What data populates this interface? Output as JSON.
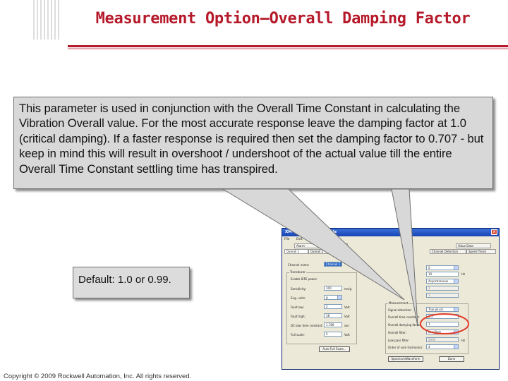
{
  "slide": {
    "title": "Measurement Option–Overall Damping Factor",
    "callout_text": "This parameter is used in conjunction with the Overall Time Constant in calculating the Vibration Overall value. For the most accurate response leave the damping factor at 1.0 (critical damping). If a faster response is required then set the damping factor to 0.707 - but keep in mind this will result in overshoot / undershoot of the actual value till the entire Overall Time Constant settling time has transpired.",
    "default_text": "Default: 1.0 or 0.99.",
    "copyright": "Copyright © 2009 Rockwell Automation, Inc. All rights reserved.",
    "colors": {
      "title": "#b5192a",
      "rule": "#b5192a",
      "callout_bg": "#d8d8d8",
      "highlight_ellipse": "#e23a2a"
    }
  },
  "dialog": {
    "title": "XM 122 gSE Vib Module",
    "close_glyph": "×",
    "menu": [
      "File",
      "Edit",
      "Device",
      "Help"
    ],
    "tabs_row1": [
      "Alarm",
      "Relay",
      "Tach",
      "Overall",
      "Spectrum",
      "Band",
      "Status Data",
      "Value Data"
    ],
    "tabs_row2": [
      "Overall 1",
      "Overall 2",
      "Spectrum/Waveform",
      "Signal Processing",
      "Overall",
      "Band 1/2/3/4",
      "Tachometer",
      "Speed/ Band",
      "Channel 1",
      "Channel 2",
      "Channel Detection",
      "Channel / Band",
      "Speed Trend"
    ],
    "left": {
      "channel_name_label": "Channel name:",
      "channel_name_value": "Channel 1",
      "transducer_group": "Transducer",
      "enable_iepe": "Enable IEPE power",
      "sensitivity_label": "Sensitivity:",
      "sensitivity_value": "100",
      "sensitivity_unit": "mv/g",
      "eng_units_label": "Eng. units:",
      "eng_units_value": "g",
      "fault_low_label": "Fault low:",
      "fault_low_value": "2",
      "fault_low_unit": "Volt",
      "fault_high_label": "Fault high:",
      "fault_high_value": "18",
      "fault_high_unit": "Volt",
      "dc_bias_label": "DC bias time constant:",
      "dc_bias_value": "1.789",
      "dc_bias_unit": "sec",
      "full_scale_label": "Full scale:",
      "full_scale_value": "5",
      "full_scale_unit": "Volt",
      "autoscale_button": "Auto Full Scale..."
    },
    "right": {
      "field1_value": "0",
      "field2_value": "10",
      "field2_unit": "Hz",
      "field3_value": "Asynchronous",
      "field4_value": "1",
      "field5_value": "1",
      "measurement_group": "Measurement",
      "signal_detection_label": "Signal detection:",
      "signal_detection_value": "True pk-pk",
      "time_constant_label": "Overall time constant:",
      "time_constant_value": "1.5",
      "damping_label": "Overall damping factor:",
      "damping_value": "1",
      "overall_filter_label": "Overall filter:",
      "overall_filter_value": "Low Pass",
      "low_pass_label": "Low pass filter:",
      "low_pass_value": "5000",
      "low_pass_unit": "Hz",
      "lines_label": "Order of sum harmonics:",
      "lines_value": "4",
      "spectrum_button": "Spectrum/Waveform",
      "done_button": "Done"
    }
  }
}
